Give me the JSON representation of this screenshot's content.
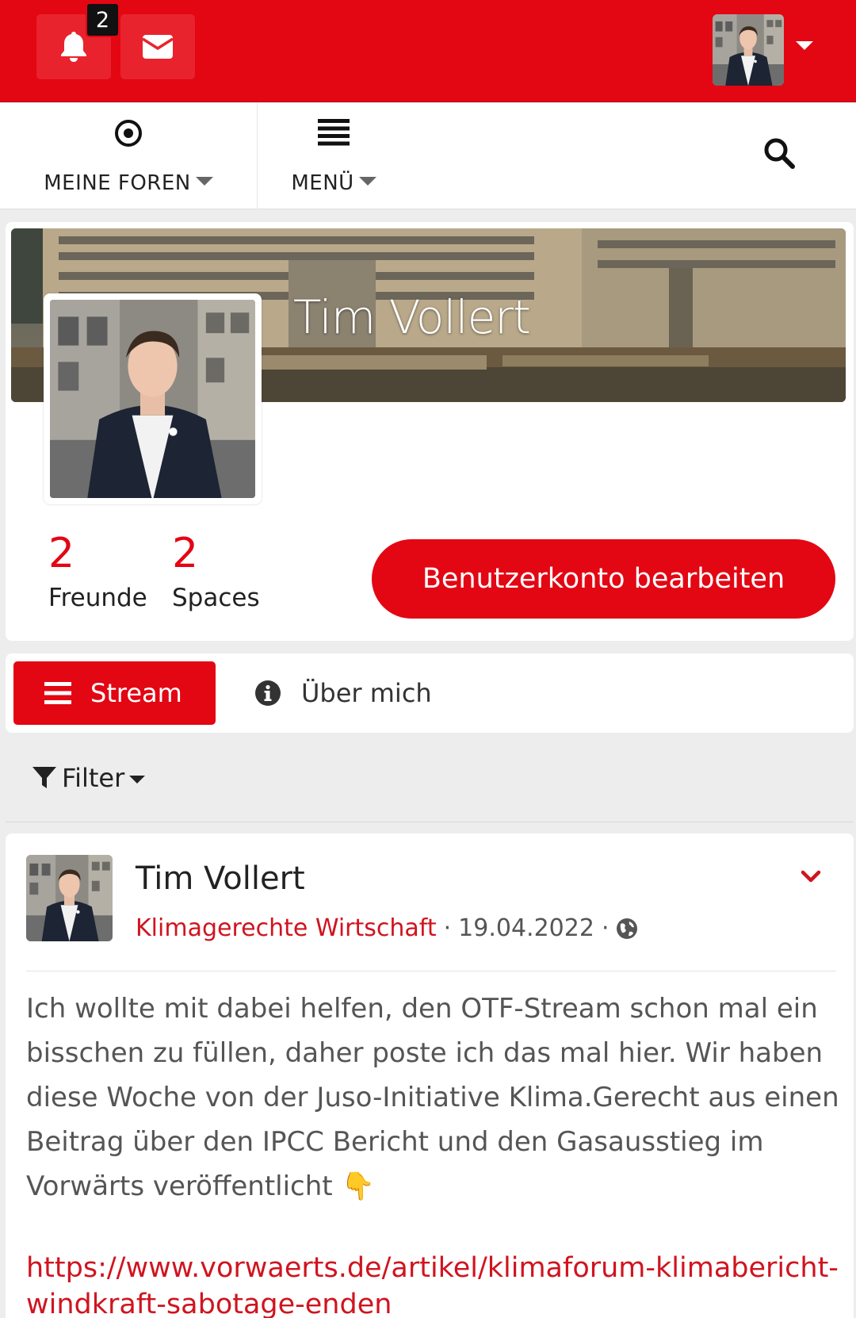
{
  "topbar": {
    "notification_count": "2",
    "icons": [
      "bell-icon",
      "envelope-icon",
      "caret-down-icon"
    ],
    "accent": "#e30613"
  },
  "nav": {
    "forums_label": "MEINE FOREN",
    "menu_label": "MENÜ",
    "icons": [
      "target-icon",
      "list-icon",
      "search-icon"
    ]
  },
  "profile": {
    "name": "Tim Vollert",
    "friends_count": "2",
    "friends_label": "Freunde",
    "spaces_count": "2",
    "spaces_label": "Spaces",
    "edit_button": "Benutzerkonto bearbeiten"
  },
  "tabs": {
    "stream_label": "Stream",
    "about_label": "Über mich"
  },
  "filter": {
    "label": "Filter"
  },
  "post": {
    "author": "Tim Vollert",
    "space": "Klimagerechte Wirtschaft",
    "date": "19.04.2022",
    "separator": "·",
    "body": "Ich wollte mit dabei helfen, den OTF-Stream schon mal ein bisschen zu füllen, daher poste ich das mal hier. Wir haben diese Woche von der Juso-Initiative Klima.Gerecht aus einen Beitrag über den IPCC Bericht und den Gasausstieg im Vorwärts veröffentlicht 👇",
    "link": "https://www.vorwaerts.de/artikel/klimaforum-klimabericht-windkraft-sabotage-enden"
  }
}
